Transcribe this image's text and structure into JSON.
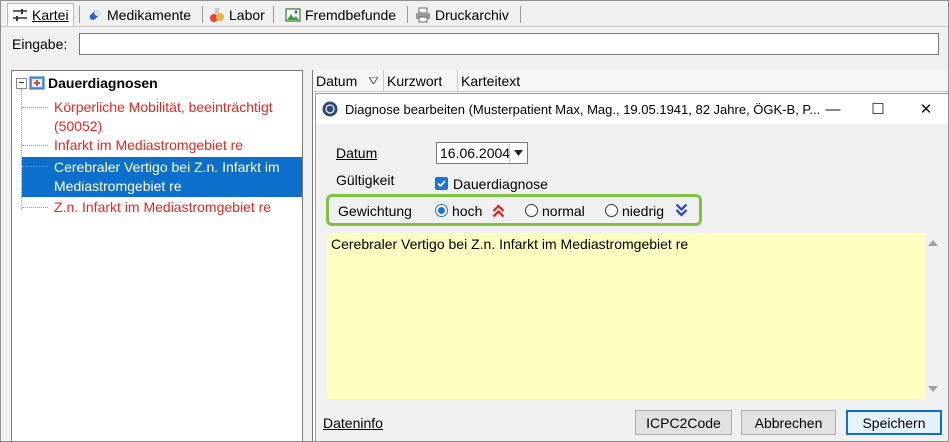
{
  "tabs": [
    {
      "label": "Kartei",
      "icon": "sliders-icon"
    },
    {
      "label": "Medikamente",
      "icon": "pill-icon"
    },
    {
      "label": "Labor",
      "icon": "lab-flask-icon"
    },
    {
      "label": "Fremdbefunde",
      "icon": "image-document-icon"
    },
    {
      "label": "Druckarchiv",
      "icon": "printer-icon"
    }
  ],
  "eingabe": {
    "label": "Eingabe:",
    "value": ""
  },
  "tree": {
    "root_label": "Dauerdiagnosen",
    "expander": "−",
    "items": [
      {
        "text": "Körperliche Mobilität, beeinträchtigt (50052)",
        "selected": false
      },
      {
        "text": "Infarkt im Mediastromgebiet re",
        "selected": false
      },
      {
        "text": "Cerebraler Vertigo bei Z.n. Infarkt im Mediastromgebiet re",
        "selected": true
      },
      {
        "text": "Z.n. Infarkt im Mediastromgebiet re",
        "selected": false
      }
    ],
    "colors": {
      "item_text": "#e8241f",
      "selected_bg": "#0b6fcb"
    }
  },
  "grid": {
    "columns": [
      "Datum",
      "Kurzwort",
      "Karteitext"
    ]
  },
  "dialog": {
    "title": "Diagnose bearbeiten (Musterpatient Max, Mag., 19.05.1941, 82 Jahre, ÖGK-B, P...",
    "window_buttons": {
      "minimize": "—",
      "maximize": "☐",
      "close": "✕"
    },
    "datum_label": "Datum",
    "datum_value": "16.06.2004",
    "gueltigkeit_label": "Gültigkeit",
    "dauerdiagnose_label": "Dauerdiagnose",
    "dauerdiagnose_checked": true,
    "gewichtung_label": "Gewichtung",
    "gewichtung_options": [
      {
        "label": "hoch",
        "checked": true,
        "icon": "double-chevron-up-red-icon"
      },
      {
        "label": "normal",
        "checked": false
      },
      {
        "label": "niedrig",
        "checked": false,
        "icon": "double-chevron-down-blue-icon"
      }
    ],
    "text": "Cerebraler Vertigo bei Z.n. Infarkt im Mediastromgebiet re",
    "dateninfo_label": "Dateninfo",
    "buttons": {
      "icpc": "ICPC2Code",
      "cancel": "Abbrechen",
      "save": "Speichern"
    },
    "colors": {
      "textarea_bg": "#ffffc0",
      "highlight_border": "#7fc241",
      "accent": "#1a73d6"
    }
  }
}
